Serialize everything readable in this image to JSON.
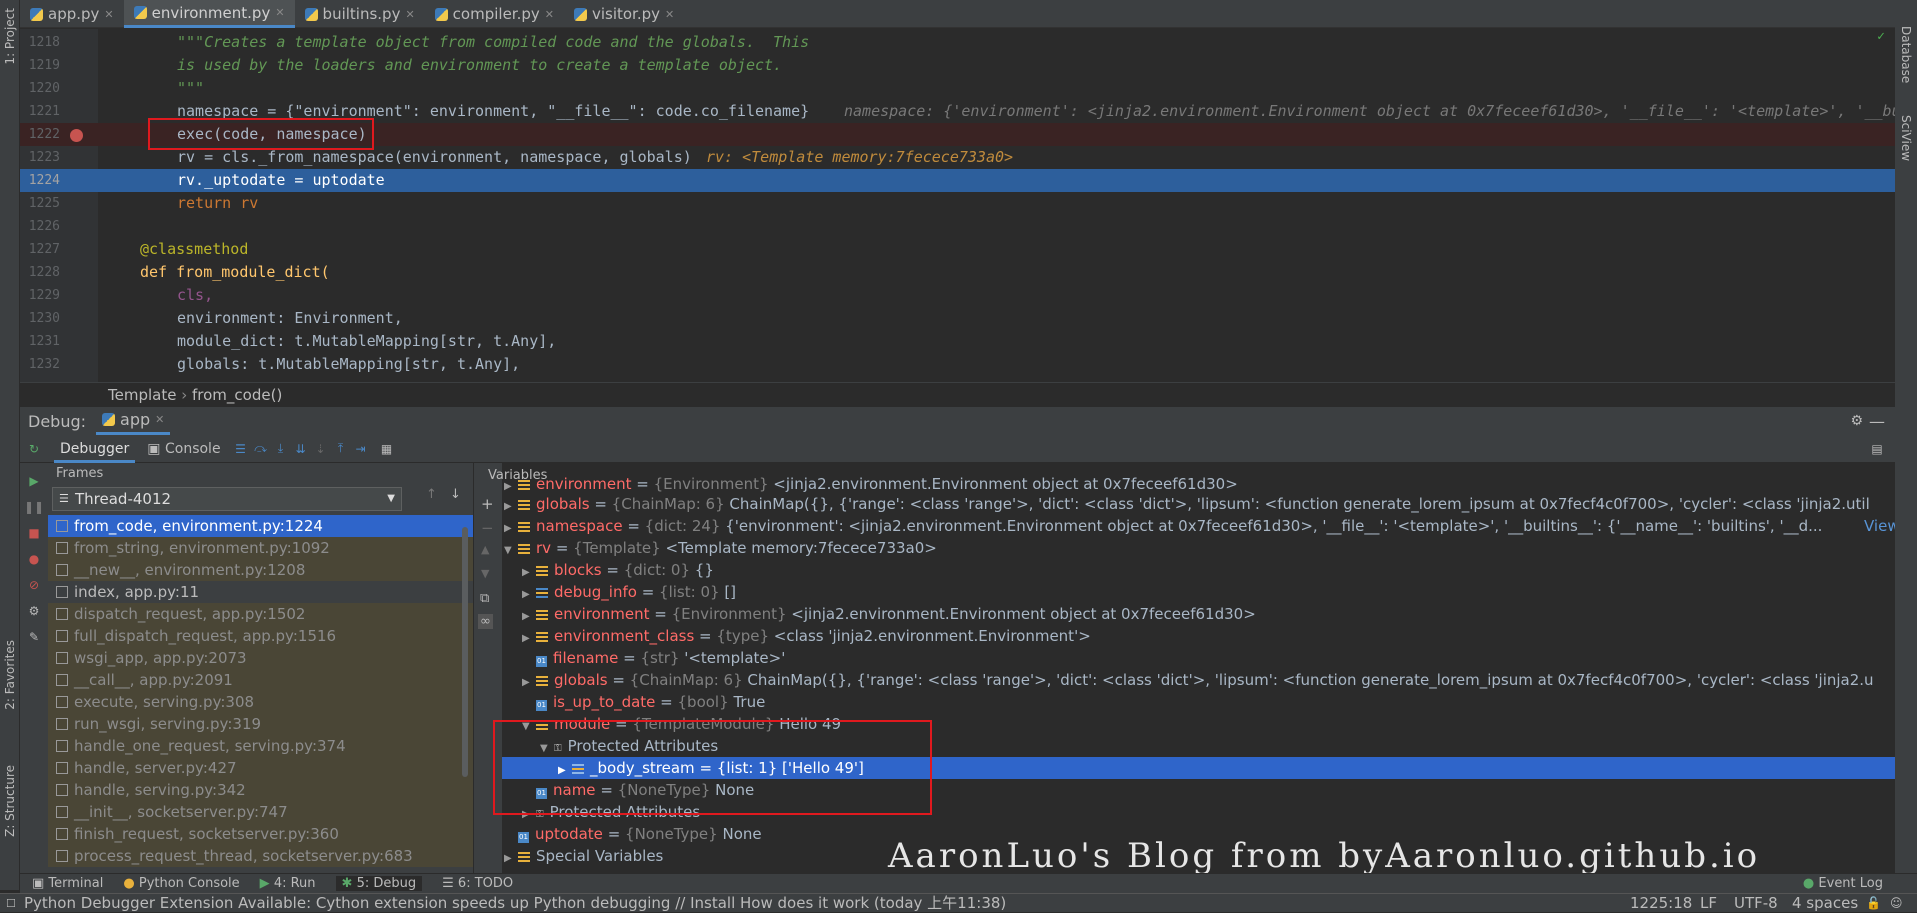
{
  "tabs": [
    {
      "label": "app.py"
    },
    {
      "label": "environment.py"
    },
    {
      "label": "builtins.py"
    },
    {
      "label": "compiler.py"
    },
    {
      "label": "visitor.py"
    }
  ],
  "left_toolbar": {
    "project": "1: Project",
    "favorites": "2: Favorites",
    "structure": "Z: Structure"
  },
  "right_toolbar": {
    "database": "Database",
    "sciview": "SciView"
  },
  "editor": {
    "lines": [
      {
        "num": "1218",
        "text": "\"\"\"Creates a template object from compiled code and the globals.  This"
      },
      {
        "num": "1219",
        "text": "is used by the loaders and environment to create a template object."
      },
      {
        "num": "1220",
        "text": "\"\"\""
      },
      {
        "num": "1221",
        "text": "namespace = {\"environment\": environment, \"__file__\": code.co_filename}",
        "hint": "namespace: {'environment': <jinja2.environment.Environment object at 0x7feceef61d30>, '__file__': '<template>', '__buil"
      },
      {
        "num": "1222",
        "text": "exec(code, namespace)"
      },
      {
        "num": "1223",
        "text": "rv = cls._from_namespace(environment, namespace, globals)",
        "hint": "rv: <Template memory:7fecece733a0>"
      },
      {
        "num": "1224",
        "text": "rv._uptodate = uptodate"
      },
      {
        "num": "1225",
        "text": "return rv"
      },
      {
        "num": "1226",
        "text": ""
      },
      {
        "num": "1227",
        "text": "@classmethod"
      },
      {
        "num": "1228",
        "text": "def from_module_dict("
      },
      {
        "num": "1229",
        "text": "cls,"
      },
      {
        "num": "1230",
        "text": "environment: Environment,"
      },
      {
        "num": "1231",
        "text": "module_dict: t.MutableMapping[str, t.Any],"
      },
      {
        "num": "1232",
        "text": "globals: t.MutableMapping[str, t.Any],"
      }
    ]
  },
  "breadcrumb": {
    "class": "Template",
    "method": "from_code()"
  },
  "debug": {
    "label": "Debug:",
    "session": "app",
    "tab_debugger": "Debugger",
    "tab_console": "Console",
    "frames_header": "Frames",
    "variables_header": "Variables",
    "thread": "Thread-4012"
  },
  "frames": [
    "from_code, environment.py:1224",
    "from_string, environment.py:1092",
    "__new__, environment.py:1208",
    "index, app.py:11",
    "dispatch_request, app.py:1502",
    "full_dispatch_request, app.py:1516",
    "wsgi_app, app.py:2073",
    "__call__, app.py:2091",
    "execute, serving.py:308",
    "run_wsgi, serving.py:319",
    "handle_one_request, serving.py:374",
    "handle, server.py:427",
    "handle, serving.py:342",
    "__init__, socketserver.py:747",
    "finish_request, socketserver.py:360",
    "process_request_thread, socketserver.py:683"
  ],
  "variables": [
    {
      "name": "environment",
      "type": "{Environment}",
      "value": "<jinja2.environment.Environment object at 0x7feceef61d30>"
    },
    {
      "name": "globals",
      "type": "{ChainMap: 6}",
      "value": "ChainMap({}, {'range': <class 'range'>, 'dict': <class 'dict'>, 'lipsum': <function generate_lorem_ipsum at 0x7fecf4c0f700>, 'cycler': <class 'jinja2.util"
    },
    {
      "name": "namespace",
      "type": "{dict: 24}",
      "value": "{'environment': <jinja2.environment.Environment object at 0x7feceef61d30>, '__file__': '<template>', '__builtins__': {'__name__': 'builtins', '__d...",
      "link": "View"
    },
    {
      "name": "rv",
      "type": "{Template}",
      "value": "<Template memory:7fecece733a0>"
    },
    {
      "name": "blocks",
      "type": "{dict: 0}",
      "value": "{}"
    },
    {
      "name": "debug_info",
      "type": "{list: 0}",
      "value": "[]"
    },
    {
      "name": "environment",
      "type": "{Environment}",
      "value": "<jinja2.environment.Environment object at 0x7feceef61d30>"
    },
    {
      "name": "environment_class",
      "type": "{type}",
      "value": "<class 'jinja2.environment.Environment'>"
    },
    {
      "name": "filename",
      "type": "{str}",
      "value": "'<template>'"
    },
    {
      "name": "globals",
      "type": "{ChainMap: 6}",
      "value": "ChainMap({}, {'range': <class 'range'>, 'dict': <class 'dict'>, 'lipsum': <function generate_lorem_ipsum at 0x7fecf4c0f700>, 'cycler': <class 'jinja2.u"
    },
    {
      "name": "is_up_to_date",
      "type": "{bool}",
      "value": "True"
    },
    {
      "name": "module",
      "type": "{TemplateModule}",
      "value": "Hello 49"
    },
    {
      "name": "Protected Attributes",
      "type": "",
      "value": ""
    },
    {
      "name": "_body_stream",
      "type": "{list: 1}",
      "value": "['Hello 49']"
    },
    {
      "name": "name",
      "type": "{NoneType}",
      "value": "None"
    },
    {
      "name": "Protected Attributes",
      "type": "",
      "value": ""
    },
    {
      "name": "uptodate",
      "type": "{NoneType}",
      "value": "None"
    },
    {
      "name": "Special Variables",
      "type": "",
      "value": ""
    }
  ],
  "watermark": "AaronLuo's Blog from byAaronluo.github.io",
  "bottom_tabs": [
    {
      "label": "Terminal"
    },
    {
      "label": "Python Console"
    },
    {
      "label": "4: Run"
    },
    {
      "label": "5: Debug"
    },
    {
      "label": "6: TODO"
    }
  ],
  "event_log": "Event Log",
  "status": {
    "message": "Python Debugger Extension Available: Cython extension speeds up Python debugging // Install   How does it work (today 上午11:38)",
    "position": "1225:18",
    "line_sep": "LF",
    "encoding": "UTF-8",
    "indent": "4 spaces"
  }
}
